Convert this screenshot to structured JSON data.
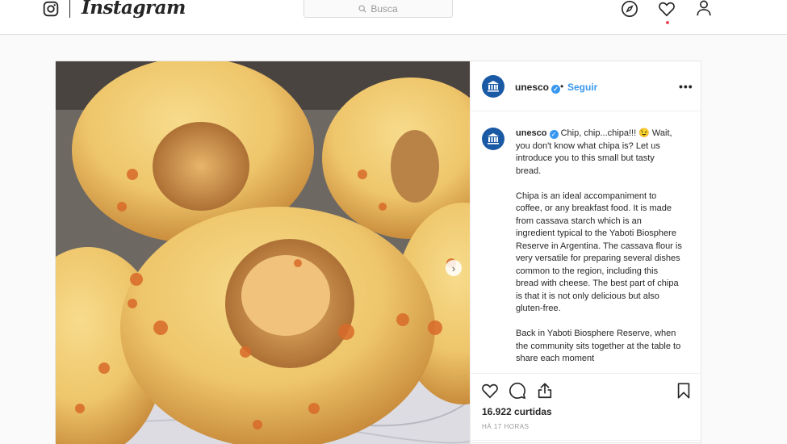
{
  "topbar": {
    "brand": "Instagram",
    "search_placeholder": "Busca",
    "icons": [
      "instagram-glyph-icon",
      "compass-icon",
      "heart-icon",
      "profile-icon",
      "search-icon"
    ]
  },
  "post": {
    "author": "unesco",
    "verified": true,
    "separator": "•",
    "follow_label": "Seguir",
    "more_label": "•••",
    "caption_user": "unesco",
    "caption_first": "Chip, chip...chipa!!! 😉 Wait, you don't know what chipa is? Let us introduce you to this small but tasty bread.",
    "caption_second": "Chipa is an ideal accompaniment to coffee, or any breakfast food. It is made from cassava starch which is an ingredient typical to the Yaboti Biosphere Reserve in Argentina. The cassava flour is very versatile for preparing several dishes common to the region, including this bread with cheese. The best part of chipa is that it is not only delicious but also gluten-free.",
    "caption_third": "Back in Yaboti Biosphere Reserve, when the community sits together at the table to share each moment",
    "next_label": "›",
    "likes": "16.922 curtidas",
    "time": "HÁ 17 HORAS"
  },
  "colors": {
    "accent": "#3897f0",
    "unesco_blue": "#1a5aa5",
    "notification": "#ed4956",
    "border": "#dbdbdb"
  }
}
